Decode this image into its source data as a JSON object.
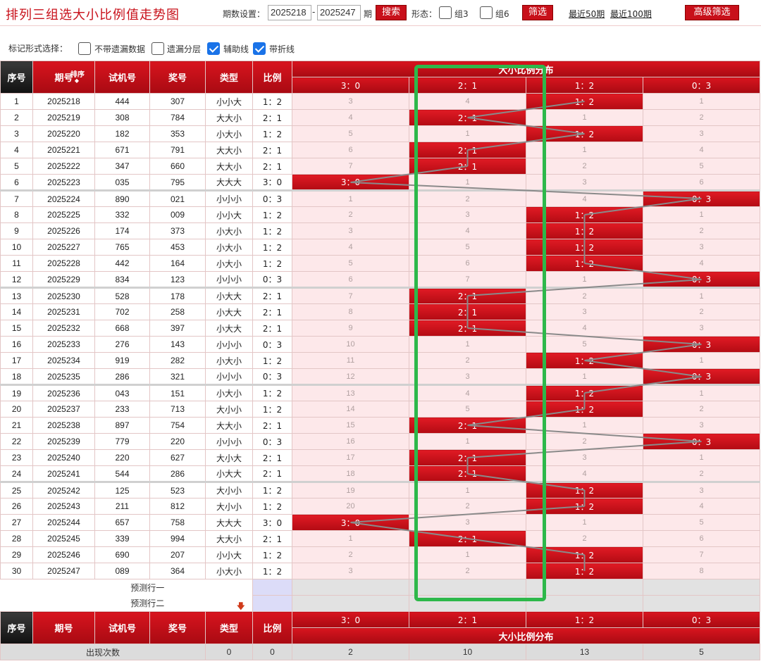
{
  "header": {
    "title": "排列三组选大小比例值走势图",
    "period_label": "期数设置：",
    "period_from": "2025218",
    "period_to": "2025247",
    "period_unit": "期",
    "search_label": "搜索",
    "shape_label": "形态：",
    "zu3_label": "组3",
    "zu6_label": "组6",
    "filter_label": "筛选",
    "recent50": "最近50期",
    "recent100": "最近100期",
    "advanced": "高级筛选"
  },
  "mark_options": {
    "label": "标记形式选择：",
    "items": [
      {
        "label": "不带遗漏数据",
        "checked": false
      },
      {
        "label": "遗漏分层",
        "checked": false
      },
      {
        "label": "辅助线",
        "checked": true
      },
      {
        "label": "带折线",
        "checked": true
      }
    ]
  },
  "table": {
    "headers": {
      "index": "序号",
      "period": "期号",
      "sort": "排序",
      "sort_glyph": "◆",
      "test": "试机号",
      "prize": "奖号",
      "type": "类型",
      "ratio": "比例",
      "dist": "大小比例分布"
    },
    "dist_columns": [
      "3：0",
      "2：1",
      "1：2",
      "0：3"
    ],
    "rows": [
      {
        "idx": "1",
        "period": "2025218",
        "test": "444",
        "prize": "307",
        "type": "小小大",
        "ratio": "1：2",
        "cells": [
          "3",
          "4",
          "1：2",
          "1"
        ],
        "hit": 2
      },
      {
        "idx": "2",
        "period": "2025219",
        "test": "308",
        "prize": "784",
        "type": "大大小",
        "ratio": "2：1",
        "cells": [
          "4",
          "2：1",
          "1",
          "2"
        ],
        "hit": 1
      },
      {
        "idx": "3",
        "period": "2025220",
        "test": "182",
        "prize": "353",
        "type": "小大小",
        "ratio": "1：2",
        "cells": [
          "5",
          "1",
          "1：2",
          "3"
        ],
        "hit": 2
      },
      {
        "idx": "4",
        "period": "2025221",
        "test": "671",
        "prize": "791",
        "type": "大大小",
        "ratio": "2：1",
        "cells": [
          "6",
          "2：1",
          "1",
          "4"
        ],
        "hit": 1
      },
      {
        "idx": "5",
        "period": "2025222",
        "test": "347",
        "prize": "660",
        "type": "大大小",
        "ratio": "2：1",
        "cells": [
          "7",
          "2：1",
          "2",
          "5"
        ],
        "hit": 1
      },
      {
        "idx": "6",
        "period": "2025223",
        "test": "035",
        "prize": "795",
        "type": "大大大",
        "ratio": "3：0",
        "cells": [
          "3：0",
          "1",
          "3",
          "6"
        ],
        "hit": 0
      },
      {
        "idx": "7",
        "period": "2025224",
        "test": "890",
        "prize": "021",
        "type": "小小小",
        "ratio": "0：3",
        "cells": [
          "1",
          "2",
          "4",
          "0：3"
        ],
        "hit": 3
      },
      {
        "idx": "8",
        "period": "2025225",
        "test": "332",
        "prize": "009",
        "type": "小小大",
        "ratio": "1：2",
        "cells": [
          "2",
          "3",
          "1：2",
          "1"
        ],
        "hit": 2
      },
      {
        "idx": "9",
        "period": "2025226",
        "test": "174",
        "prize": "373",
        "type": "小大小",
        "ratio": "1：2",
        "cells": [
          "3",
          "4",
          "1：2",
          "2"
        ],
        "hit": 2
      },
      {
        "idx": "10",
        "period": "2025227",
        "test": "765",
        "prize": "453",
        "type": "小大小",
        "ratio": "1：2",
        "cells": [
          "4",
          "5",
          "1：2",
          "3"
        ],
        "hit": 2
      },
      {
        "idx": "11",
        "period": "2025228",
        "test": "442",
        "prize": "164",
        "type": "小大小",
        "ratio": "1：2",
        "cells": [
          "5",
          "6",
          "1：2",
          "4"
        ],
        "hit": 2
      },
      {
        "idx": "12",
        "period": "2025229",
        "test": "834",
        "prize": "123",
        "type": "小小小",
        "ratio": "0：3",
        "cells": [
          "6",
          "7",
          "1",
          "0：3"
        ],
        "hit": 3
      },
      {
        "idx": "13",
        "period": "2025230",
        "test": "528",
        "prize": "178",
        "type": "小大大",
        "ratio": "2：1",
        "cells": [
          "7",
          "2：1",
          "2",
          "1"
        ],
        "hit": 1
      },
      {
        "idx": "14",
        "period": "2025231",
        "test": "702",
        "prize": "258",
        "type": "小大大",
        "ratio": "2：1",
        "cells": [
          "8",
          "2：1",
          "3",
          "2"
        ],
        "hit": 1
      },
      {
        "idx": "15",
        "period": "2025232",
        "test": "668",
        "prize": "397",
        "type": "小大大",
        "ratio": "2：1",
        "cells": [
          "9",
          "2：1",
          "4",
          "3"
        ],
        "hit": 1
      },
      {
        "idx": "16",
        "period": "2025233",
        "test": "276",
        "prize": "143",
        "type": "小小小",
        "ratio": "0：3",
        "cells": [
          "10",
          "1",
          "5",
          "0：3"
        ],
        "hit": 3
      },
      {
        "idx": "17",
        "period": "2025234",
        "test": "919",
        "prize": "282",
        "type": "小大小",
        "ratio": "1：2",
        "cells": [
          "11",
          "2",
          "1：2",
          "1"
        ],
        "hit": 2
      },
      {
        "idx": "18",
        "period": "2025235",
        "test": "286",
        "prize": "321",
        "type": "小小小",
        "ratio": "0：3",
        "cells": [
          "12",
          "3",
          "1",
          "0：3"
        ],
        "hit": 3
      },
      {
        "idx": "19",
        "period": "2025236",
        "test": "043",
        "prize": "151",
        "type": "小大小",
        "ratio": "1：2",
        "cells": [
          "13",
          "4",
          "1：2",
          "1"
        ],
        "hit": 2
      },
      {
        "idx": "20",
        "period": "2025237",
        "test": "233",
        "prize": "713",
        "type": "大小小",
        "ratio": "1：2",
        "cells": [
          "14",
          "5",
          "1：2",
          "2"
        ],
        "hit": 2
      },
      {
        "idx": "21",
        "period": "2025238",
        "test": "897",
        "prize": "754",
        "type": "大大小",
        "ratio": "2：1",
        "cells": [
          "15",
          "2：1",
          "1",
          "3"
        ],
        "hit": 1
      },
      {
        "idx": "22",
        "period": "2025239",
        "test": "779",
        "prize": "220",
        "type": "小小小",
        "ratio": "0：3",
        "cells": [
          "16",
          "1",
          "2",
          "0：3"
        ],
        "hit": 3
      },
      {
        "idx": "23",
        "period": "2025240",
        "test": "220",
        "prize": "627",
        "type": "大小大",
        "ratio": "2：1",
        "cells": [
          "17",
          "2：1",
          "3",
          "1"
        ],
        "hit": 1
      },
      {
        "idx": "24",
        "period": "2025241",
        "test": "544",
        "prize": "286",
        "type": "小大大",
        "ratio": "2：1",
        "cells": [
          "18",
          "2：1",
          "4",
          "2"
        ],
        "hit": 1
      },
      {
        "idx": "25",
        "period": "2025242",
        "test": "125",
        "prize": "523",
        "type": "大小小",
        "ratio": "1：2",
        "cells": [
          "19",
          "1",
          "1：2",
          "3"
        ],
        "hit": 2
      },
      {
        "idx": "26",
        "period": "2025243",
        "test": "211",
        "prize": "812",
        "type": "大小小",
        "ratio": "1：2",
        "cells": [
          "20",
          "2",
          "1：2",
          "4"
        ],
        "hit": 2
      },
      {
        "idx": "27",
        "period": "2025244",
        "test": "657",
        "prize": "758",
        "type": "大大大",
        "ratio": "3：0",
        "cells": [
          "3：0",
          "3",
          "1",
          "5"
        ],
        "hit": 0
      },
      {
        "idx": "28",
        "period": "2025245",
        "test": "339",
        "prize": "994",
        "type": "大大小",
        "ratio": "2：1",
        "cells": [
          "1",
          "2：1",
          "2",
          "6"
        ],
        "hit": 1
      },
      {
        "idx": "29",
        "period": "2025246",
        "test": "690",
        "prize": "207",
        "type": "小小大",
        "ratio": "1：2",
        "cells": [
          "2",
          "1",
          "1：2",
          "7"
        ],
        "hit": 2
      },
      {
        "idx": "30",
        "period": "2025247",
        "test": "089",
        "prize": "364",
        "type": "小大小",
        "ratio": "1：2",
        "cells": [
          "3",
          "2",
          "1：2",
          "8"
        ],
        "hit": 2
      }
    ],
    "predict1": "预测行一",
    "predict2": "预测行二",
    "predict_arrow": "🡇",
    "count_label": "出现次数",
    "counts": {
      "type": "0",
      "ratio": "0",
      "dist": [
        "2",
        "10",
        "13",
        "5"
      ]
    }
  },
  "colors": {
    "accent": "#c8101a",
    "hit_cell": "#d0141d",
    "miss_cell": "#fde8ea",
    "highlight_box": "#2db84a",
    "trend_line": "#8a8a8a"
  }
}
